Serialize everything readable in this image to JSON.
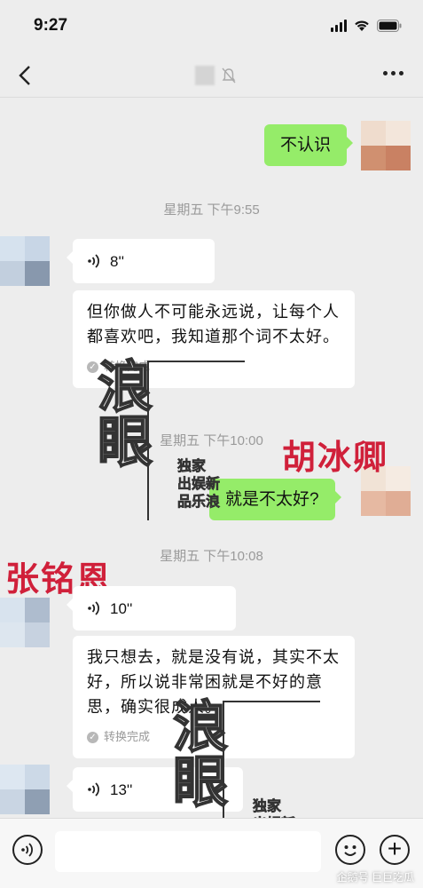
{
  "status": {
    "time": "9:27"
  },
  "messages": {
    "m1": {
      "text": "不认识"
    },
    "ts1": "星期五 下午9:55",
    "m2": {
      "duration": "8''",
      "transcript": "但你做人不可能永远说，让每个人都喜欢吧，我知道那个词不太好。",
      "status": "转换完成"
    },
    "ts2": "星期五 下午10:00",
    "m3": {
      "text": "就是不太好?"
    },
    "ts3": "星期五 下午10:08",
    "m4": {
      "duration": "10''",
      "transcript": "我只想去，就是没有说，其实不太好，所以说非常困就是不好的意思，确实很成人。",
      "status": "转换完成"
    },
    "m5": {
      "duration": "13''"
    }
  },
  "overlays": {
    "name_right": "胡冰卿",
    "name_left": "张铭恩",
    "watermark_big": "浪眼",
    "watermark_small_1": "独家",
    "watermark_small_2": "出娱新",
    "watermark_small_3": "品乐浪",
    "source": "企鹅号 巨巨吃瓜"
  },
  "colors": {
    "background": "#ededed",
    "bubble_out": "#95ec69",
    "bubble_in": "#ffffff",
    "overlay_red": "#d0203a"
  }
}
